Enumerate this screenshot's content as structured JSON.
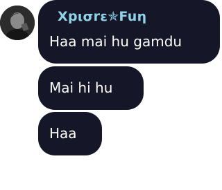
{
  "avatar": {
    "icon": "user-avatar-photo"
  },
  "messages": [
    {
      "sender": "Xpισrε✯Fuη",
      "sender_color": "#8fd3e8",
      "text": "Haa mai hu gamdu"
    },
    {
      "text": "Mai hi hu"
    },
    {
      "text": "Haa"
    }
  ],
  "colors": {
    "bubble": "#161629",
    "text": "#ffffff",
    "background": "#ffffff"
  }
}
